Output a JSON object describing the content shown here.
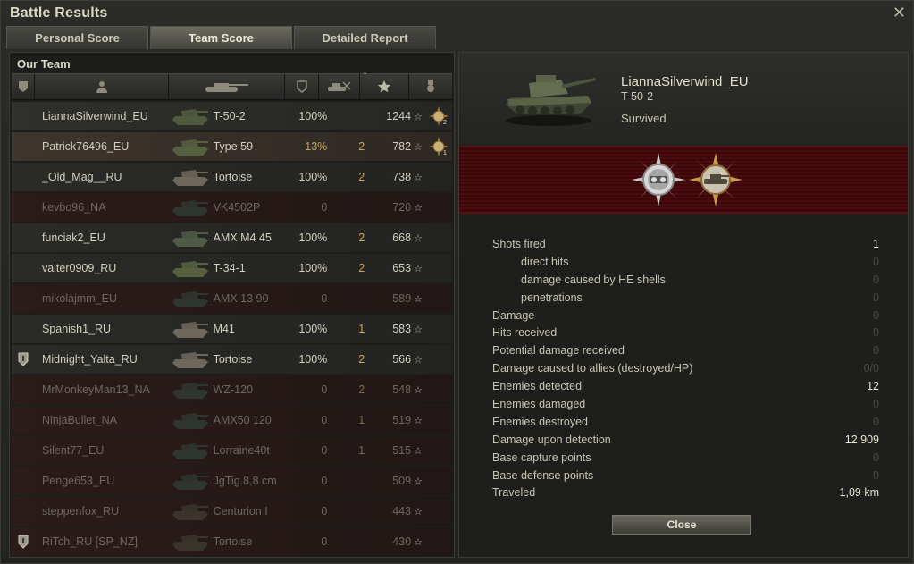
{
  "window": {
    "title": "Battle Results",
    "close_symbol": "✕"
  },
  "tabs": [
    {
      "label": "Personal Score",
      "active": false
    },
    {
      "label": "Team Score",
      "active": true
    },
    {
      "label": "Detailed Report",
      "active": false
    }
  ],
  "team": {
    "label": "Our Team",
    "sort_indicator": "ˇ",
    "header_icons": [
      "squad-column-icon",
      "player-column-icon",
      "tank-column-icon",
      "armor-column-icon",
      "kills-column-icon",
      "experience-star-icon",
      "medal-column-icon"
    ],
    "rows": [
      {
        "name": "LiannaSilverwind_EU",
        "vehicle": "T-50-2",
        "hp": "100%",
        "kills": "",
        "xp": "1244",
        "state": "selected",
        "squad": false,
        "medal": "2",
        "tank_color": "#4f5a3e"
      },
      {
        "name": "Patrick76496_EU",
        "vehicle": "Type 59",
        "hp": "13%",
        "kills": "2",
        "xp": "782",
        "state": "highlight",
        "squad": false,
        "medal": "1",
        "tank_color": "#55613f"
      },
      {
        "name": "_Old_Mag__RU",
        "vehicle": "Tortoise",
        "hp": "100%",
        "kills": "2",
        "xp": "738",
        "state": "alive",
        "squad": false,
        "medal": "",
        "tank_color": "#6e675c"
      },
      {
        "name": "kevbo96_NA",
        "vehicle": "VK4502P",
        "hp": "0",
        "kills": "",
        "xp": "720",
        "state": "dead",
        "squad": false,
        "medal": "",
        "tank_color": "#2f3530"
      },
      {
        "name": "funciak2_EU",
        "vehicle": "AMX M4 45",
        "hp": "100%",
        "kills": "2",
        "xp": "668",
        "state": "alive",
        "squad": false,
        "medal": "",
        "tank_color": "#4f5a47"
      },
      {
        "name": "valter0909_RU",
        "vehicle": "T-34-1",
        "hp": "100%",
        "kills": "2",
        "xp": "653",
        "state": "alive",
        "squad": false,
        "medal": "",
        "tank_color": "#55613f"
      },
      {
        "name": "mikolajmm_EU",
        "vehicle": "AMX 13 90",
        "hp": "0",
        "kills": "",
        "xp": "589",
        "state": "dead",
        "squad": false,
        "medal": "",
        "tank_color": "#2f3530"
      },
      {
        "name": "Spanish1_RU",
        "vehicle": "M41",
        "hp": "100%",
        "kills": "1",
        "xp": "583",
        "state": "alive",
        "squad": false,
        "medal": "",
        "tank_color": "#6e675c"
      },
      {
        "name": "Midnight_Yalta_RU",
        "vehicle": "Tortoise",
        "hp": "100%",
        "kills": "2",
        "xp": "566",
        "state": "alive",
        "squad": true,
        "medal": "",
        "tank_color": "#6e675c"
      },
      {
        "name": "MrMonkeyMan13_NA",
        "vehicle": "WZ-120",
        "hp": "0",
        "kills": "2",
        "xp": "548",
        "state": "dead",
        "squad": false,
        "medal": "",
        "tank_color": "#2f3530"
      },
      {
        "name": "NinjaBullet_NA",
        "vehicle": "AMX50 120",
        "hp": "0",
        "kills": "1",
        "xp": "519",
        "state": "dead",
        "squad": false,
        "medal": "",
        "tank_color": "#2f3530"
      },
      {
        "name": "Silent77_EU",
        "vehicle": "Lorraine40t",
        "hp": "0",
        "kills": "1",
        "xp": "515",
        "state": "dead",
        "squad": false,
        "medal": "",
        "tank_color": "#2f3530"
      },
      {
        "name": "Penge653_EU",
        "vehicle": "JgTig.8,8 cm",
        "hp": "0",
        "kills": "",
        "xp": "509",
        "state": "dead",
        "squad": false,
        "medal": "",
        "tank_color": "#2f3530"
      },
      {
        "name": "steppenfox_RU",
        "vehicle": "Centurion I",
        "hp": "0",
        "kills": "",
        "xp": "443",
        "state": "dead",
        "squad": false,
        "medal": "",
        "tank_color": "#3a342c"
      },
      {
        "name": "RiTch_RU [SP_NZ]",
        "vehicle": "Tortoise",
        "hp": "0",
        "kills": "",
        "xp": "430",
        "state": "dead",
        "squad": true,
        "medal": "",
        "tank_color": "#3a342c"
      }
    ]
  },
  "detail": {
    "player": "LiannaSilverwind_EU",
    "vehicle": "T-50-2",
    "status": "Survived",
    "medals": [
      "scout-medal-icon",
      "tank-sniper-medal-icon"
    ],
    "stats": [
      {
        "label": "Shots fired",
        "value": "1",
        "sub": false
      },
      {
        "label": "direct hits",
        "value": "0",
        "sub": true
      },
      {
        "label": "damage caused by HE shells",
        "value": "0",
        "sub": true
      },
      {
        "label": "penetrations",
        "value": "0",
        "sub": true
      },
      {
        "label": "Damage",
        "value": "0",
        "sub": false
      },
      {
        "label": "Hits received",
        "value": "0",
        "sub": false
      },
      {
        "label": "Potential damage received",
        "value": "0",
        "sub": false
      },
      {
        "label": "Damage caused to allies (destroyed/HP)",
        "value": "0/0",
        "sub": false
      },
      {
        "label": "Enemies detected",
        "value": "12",
        "sub": false
      },
      {
        "label": "Enemies damaged",
        "value": "0",
        "sub": false
      },
      {
        "label": "Enemies destroyed",
        "value": "0",
        "sub": false
      },
      {
        "label": "Damage upon detection",
        "value": "12 909",
        "sub": false
      },
      {
        "label": "Base capture points",
        "value": "0",
        "sub": false
      },
      {
        "label": "Base defense points",
        "value": "0",
        "sub": false
      },
      {
        "label": "Traveled",
        "value": "1,09 km",
        "sub": false
      }
    ],
    "close_label": "Close"
  },
  "colors": {
    "accent_gold": "#c7a55c",
    "dead_row": "#2b1b19",
    "banner_red": "#4a0c0e"
  }
}
